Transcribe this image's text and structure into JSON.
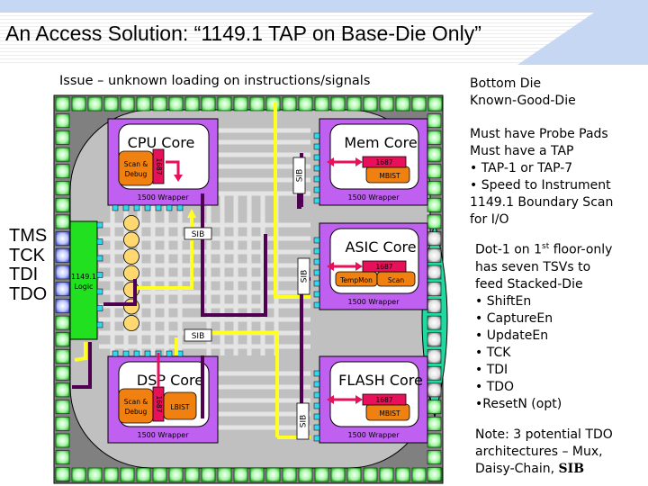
{
  "slide": {
    "title": "An Access Solution: “1149.1 TAP on Base-Die Only”",
    "issue": "Issue – unknown loading on instructions/signals"
  },
  "tap_pins": [
    "TMS",
    "TCK",
    "TDI",
    "TDO"
  ],
  "diagram": {
    "logic_block": {
      "line1": "1149.1",
      "line2": "Logic"
    },
    "cores": [
      {
        "name": "CPU Core",
        "wrapper": "1500 Wrapper",
        "ijtag": "1687",
        "instruments": [
          "Scan & Debug"
        ]
      },
      {
        "name": "Mem Core",
        "wrapper": "1500 Wrapper",
        "ijtag": "1687",
        "instruments": [
          "MBIST"
        ]
      },
      {
        "name": "ASIC Core",
        "wrapper": "1500 Wrapper",
        "ijtag": "1687",
        "instruments": [
          "TempMon",
          "Scan"
        ]
      },
      {
        "name": "DSP Core",
        "wrapper": "1500 Wrapper",
        "ijtag": "1687",
        "instruments": [
          "Scan & Debug",
          "LBIST"
        ]
      },
      {
        "name": "FLASH Core",
        "wrapper": "1500 Wrapper",
        "ijtag": "1687",
        "instruments": [
          "MBIST"
        ]
      }
    ],
    "sib_label": "SIB",
    "colors": {
      "wrapper": "#c060f0",
      "ijtag": "#e8105a",
      "instrument": "#f08010",
      "logic": "#20e020",
      "sib_path_select": "#ffff20",
      "sib_path_return": "#500050",
      "tsv_region": "#20d8a0",
      "die_fill": "#c0c0c0",
      "pad": "#80f080",
      "port": "#30d8f0"
    }
  },
  "notes": {
    "bottom_die": [
      "Bottom Die",
      "Known-Good-Die"
    ],
    "requirements": [
      "Must have Probe Pads",
      "Must have a TAP",
      "• TAP-1 or TAP-7",
      "• Speed to Instrument",
      "1149.1 Boundary Scan",
      "for I/O"
    ],
    "dot1_intro": [
      "Dot-1 on 1",
      "st",
      " floor-only",
      "has seven TSVs to",
      "feed Stacked-Die"
    ],
    "tsv_signals": [
      "• ShiftEn",
      "• CaptureEn",
      "• UpdateEn",
      "• TCK",
      "• TDI",
      "• TDO",
      "•ResetN (opt)"
    ],
    "note_lines": [
      "Note: 3 potential TDO",
      "architectures – Mux,"
    ],
    "note_last_prefix": "Daisy-Chain, ",
    "note_last_bold": "SIB"
  }
}
